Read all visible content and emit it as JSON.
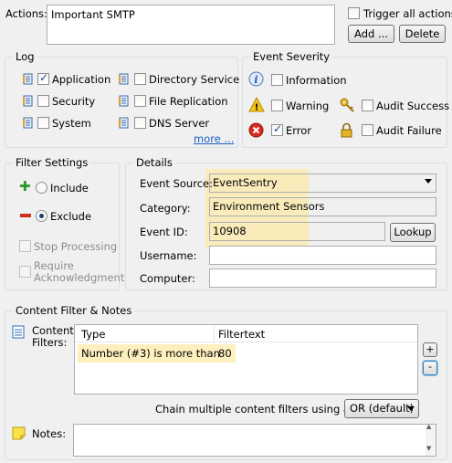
{
  "actions": {
    "label": "Actions:",
    "list_item": "Important SMTP",
    "trigger_all_label": "Trigger all actions",
    "add_button": "Add ...",
    "delete_button": "Delete"
  },
  "log": {
    "title": "Log",
    "items": [
      {
        "label": "Application",
        "checked": true
      },
      {
        "label": "Security",
        "checked": false
      },
      {
        "label": "System",
        "checked": false
      },
      {
        "label": "Directory Service",
        "checked": false
      },
      {
        "label": "File Replication",
        "checked": false
      },
      {
        "label": "DNS Server",
        "checked": false
      }
    ],
    "more_link": "more ..."
  },
  "severity": {
    "title": "Event Severity",
    "items": [
      {
        "label": "Information",
        "checked": false,
        "icon": "info-icon"
      },
      {
        "label": "Warning",
        "checked": false,
        "icon": "warning-icon"
      },
      {
        "label": "Error",
        "checked": true,
        "icon": "error-icon"
      },
      {
        "label": "Audit Success",
        "checked": false,
        "icon": "key-icon"
      },
      {
        "label": "Audit Failure",
        "checked": false,
        "icon": "lock-icon"
      }
    ]
  },
  "filter_settings": {
    "title": "Filter Settings",
    "include_label": "Include",
    "exclude_label": "Exclude",
    "selected": "Exclude",
    "stop_processing_label": "Stop Processing",
    "require_ack_label": "Require Acknowledgment"
  },
  "details": {
    "title": "Details",
    "event_source_label": "Event Source:",
    "event_source_value": "EventSentry",
    "category_label": "Category:",
    "category_value": "Environment Sensors",
    "event_id_label": "Event ID:",
    "event_id_value": "10908",
    "lookup_button": "Lookup",
    "username_label": "Username:",
    "username_value": "",
    "computer_label": "Computer:",
    "computer_value": ""
  },
  "content_filter": {
    "title": "Content Filter & Notes",
    "filters_label": "Content Filters:",
    "columns": [
      "Type",
      "Filtertext"
    ],
    "rows": [
      {
        "type": "Number (#3) is more than",
        "filtertext": "80"
      }
    ],
    "add_button": "+",
    "remove_button": "-",
    "chain_label": "Chain multiple content filters using a logical",
    "chain_value": "OR (default)",
    "notes_label": "Notes:",
    "notes_value": ""
  },
  "colors": {
    "highlight": "#fde9a8",
    "group_border": "#d5dfe5",
    "link": "#1a5fc7"
  }
}
